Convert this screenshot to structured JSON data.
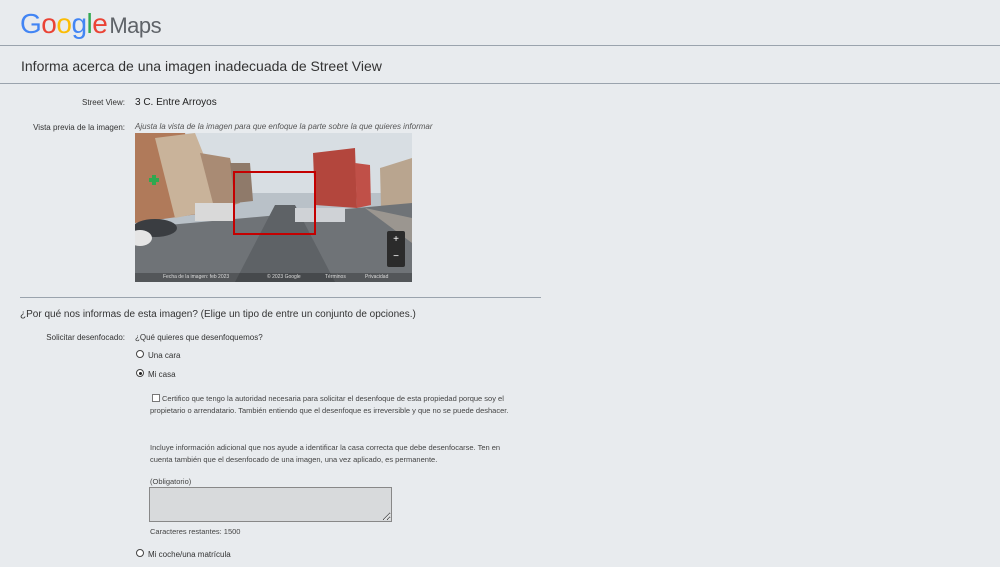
{
  "header": {
    "logo_google": "Google",
    "logo_maps": "Maps",
    "page_title": "Informa acerca de una imagen inadecuada de Street View"
  },
  "street_view": {
    "label": "Street View:",
    "value": "3 C. Entre Arroyos"
  },
  "preview": {
    "label": "Vista previa de la imagen:",
    "hint": "Ajusta la vista de la imagen para que enfoque la parte sobre la que quieres informar",
    "zoom_in": "+",
    "zoom_out": "−",
    "attribution": {
      "date": "Fecha de la imagen: feb 2023",
      "copyright": "© 2023 Google",
      "terms": "Términos",
      "privacy": "Privacidad"
    }
  },
  "reason": {
    "title": "¿Por qué nos informas de esta imagen?  (Elige un tipo de entre un conjunto de opciones.)",
    "blur_label": "Solicitar desenfocado:",
    "blur_question": "¿Qué quieres que desenfoquemos?",
    "options": [
      {
        "label": "Una cara",
        "selected": false
      },
      {
        "label": "Mi casa",
        "selected": true
      },
      {
        "label": "Mi coche/una matrícula",
        "selected": false
      }
    ]
  },
  "house_form": {
    "certify": "Certifico que tengo la autoridad necesaria para solicitar el desenfoque de esta propiedad porque soy el propietario o arrendatario. También entiendo que el desenfoque es irreversible y que no se puede deshacer.",
    "info": "Incluye información adicional que nos ayude a identificar la casa correcta que debe desenfocarse. Ten en cuenta también que el desenfocado de una imagen, una vez aplicado, es permanente.",
    "required": "(Obligatorio)",
    "textarea_value": "",
    "remaining": "Caracteres restantes: 1500"
  }
}
